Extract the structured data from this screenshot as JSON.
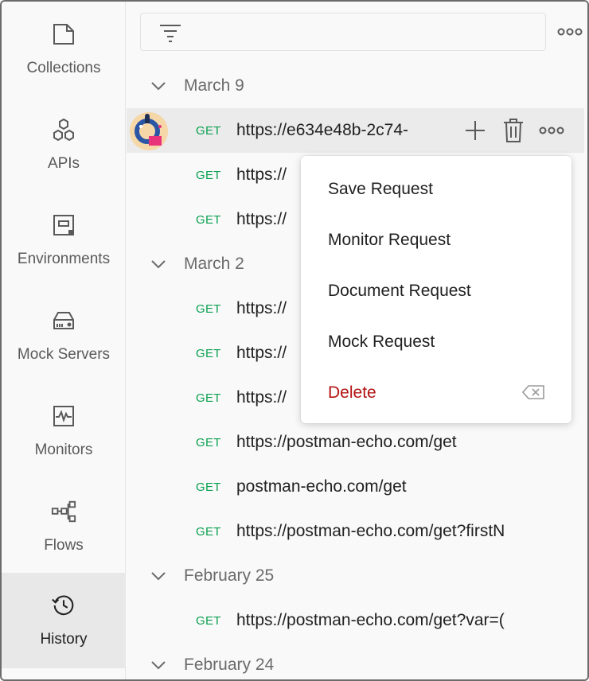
{
  "sidebar": {
    "items": [
      {
        "label": "Collections",
        "icon": "collection-icon"
      },
      {
        "label": "APIs",
        "icon": "apis-icon"
      },
      {
        "label": "Environments",
        "icon": "environment-icon"
      },
      {
        "label": "Mock Servers",
        "icon": "mock-server-icon"
      },
      {
        "label": "Monitors",
        "icon": "monitor-icon"
      },
      {
        "label": "Flows",
        "icon": "flows-icon"
      },
      {
        "label": "History",
        "icon": "history-icon",
        "active": true
      }
    ]
  },
  "history": {
    "groups": [
      {
        "title": "March 9",
        "requests": [
          {
            "method": "GET",
            "url": "https://e634e48b-2c74-"
          },
          {
            "method": "GET",
            "url": "https://"
          },
          {
            "method": "GET",
            "url": "https://"
          }
        ]
      },
      {
        "title": "March 2",
        "requests": [
          {
            "method": "GET",
            "url": "https://"
          },
          {
            "method": "GET",
            "url": "https://"
          },
          {
            "method": "GET",
            "url": "https://"
          },
          {
            "method": "GET",
            "url": "https://postman-echo.com/get"
          },
          {
            "method": "GET",
            "url": "postman-echo.com/get"
          },
          {
            "method": "GET",
            "url": "https://postman-echo.com/get?firstN"
          }
        ]
      },
      {
        "title": "February 25",
        "requests": [
          {
            "method": "GET",
            "url": "https://postman-echo.com/get?var=("
          }
        ]
      },
      {
        "title": "February 24",
        "requests": []
      }
    ]
  },
  "context_menu": {
    "items": [
      {
        "label": "Save Request"
      },
      {
        "label": "Monitor Request"
      },
      {
        "label": "Document Request"
      },
      {
        "label": "Mock Request"
      },
      {
        "label": "Delete",
        "danger": true,
        "shortcut_icon": "backspace-icon"
      }
    ]
  },
  "colors": {
    "get_method": "#0aa04f",
    "danger": "#b31313",
    "active_sidebar_bg": "#e8e8e8",
    "hover_row_bg": "#ebebeb"
  }
}
